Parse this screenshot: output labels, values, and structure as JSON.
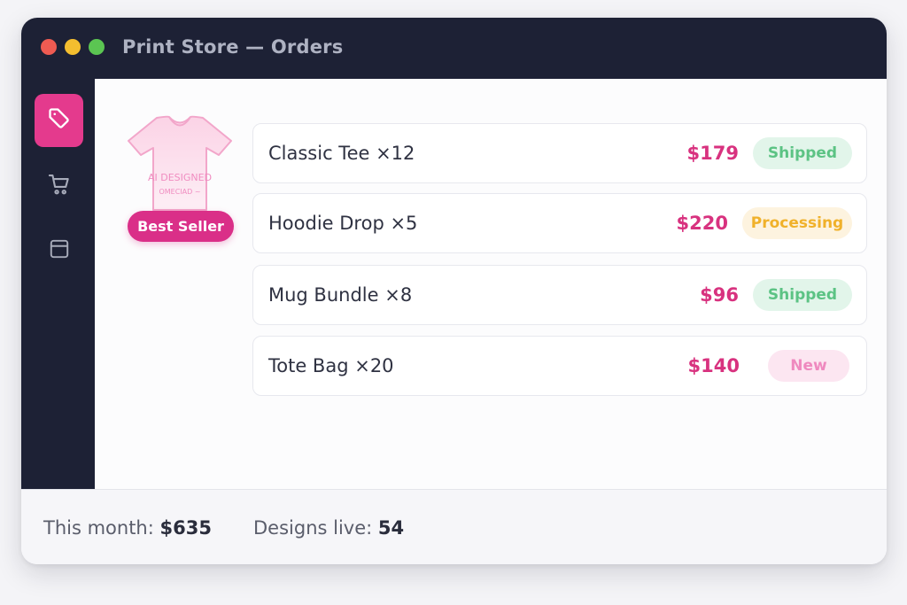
{
  "window": {
    "title": "Print Store — Orders",
    "controls": [
      "close",
      "minimize",
      "maximize"
    ],
    "control_colors": {
      "close": "#ee5b52",
      "minimize": "#f4be2f",
      "maximize": "#5bc552"
    }
  },
  "colors": {
    "accent": "#e43a8d",
    "chrome": "#1d2135",
    "price": "#d8327f",
    "shipped": "#5cc384",
    "processing": "#f0b12a",
    "new": "#ef89bf"
  },
  "sidebar": {
    "items": [
      {
        "icon": "tag-icon",
        "active": true
      },
      {
        "icon": "cart-icon",
        "active": false
      },
      {
        "icon": "layout-icon",
        "active": false
      }
    ]
  },
  "product": {
    "shirt_text_line1": "AI DESIGNED",
    "shirt_text_line2": "OMECIAD ~",
    "badge": "Best Seller"
  },
  "orders": [
    {
      "label": "Classic Tee  ×12",
      "price": "$179",
      "status": "Shipped",
      "status_type": "shipped"
    },
    {
      "label": "Hoodie Drop ×5",
      "price": "$220",
      "status": "Processing",
      "status_type": "processing"
    },
    {
      "label": "Mug Bundle ×8",
      "price": "$96",
      "status": "Shipped",
      "status_type": "shipped"
    },
    {
      "label": "Tote Bag ×20",
      "price": "$140",
      "status": "New",
      "status_type": "new"
    }
  ],
  "footer": {
    "month_label": "This month:",
    "month_value": "$635",
    "designs_label": "Designs live:",
    "designs_value": "54"
  }
}
